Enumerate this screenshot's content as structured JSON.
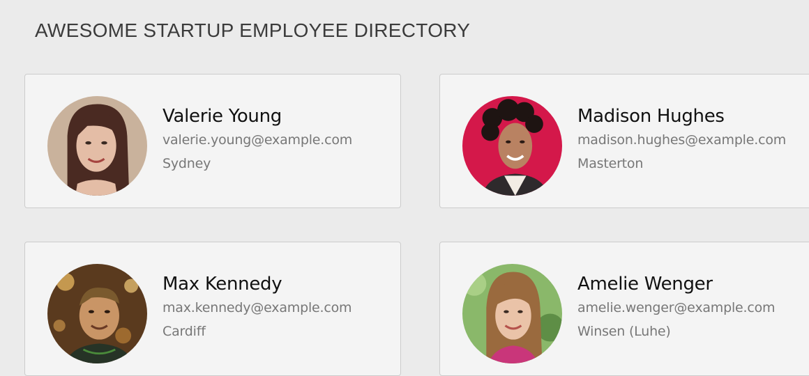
{
  "header": {
    "title": "AWESOME STARTUP EMPLOYEE DIRECTORY"
  },
  "employees": [
    {
      "name": "Valerie Young",
      "email": "valerie.young@example.com",
      "location": "Sydney"
    },
    {
      "name": "Madison Hughes",
      "email": "madison.hughes@example.com",
      "location": "Masterton"
    },
    {
      "name": "Max Kennedy",
      "email": "max.kennedy@example.com",
      "location": "Cardiff"
    },
    {
      "name": "Amelie Wenger",
      "email": "amelie.wenger@example.com",
      "location": "Winsen (Luhe)"
    }
  ]
}
